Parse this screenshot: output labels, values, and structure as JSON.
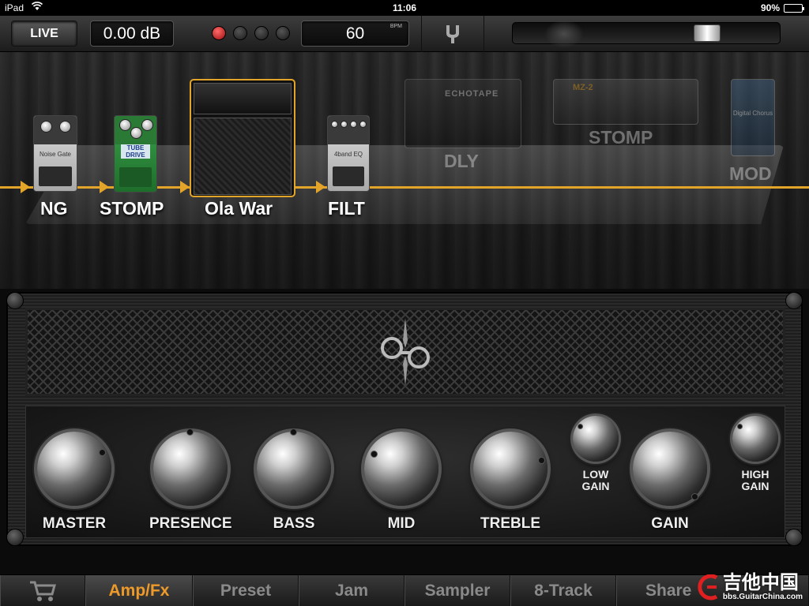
{
  "status_bar": {
    "device": "iPad",
    "time": "11:06",
    "battery": "90%",
    "battery_level": 0.9
  },
  "toolbar": {
    "live_label": "LIVE",
    "level_display": "0.00 dB",
    "bpm_value": "60",
    "bpm_unit": "BPM",
    "tuner_icon": "tuning-fork-icon",
    "volume_slider_level": 0.75,
    "record_led_color": "#c81818"
  },
  "signal_chain": {
    "accent_color": "#e3a42a",
    "units": [
      {
        "label": "NG",
        "device_text": "Noise Gate",
        "active": true
      },
      {
        "label": "STOMP",
        "device_text": "TUBE DRIVE",
        "active": true
      },
      {
        "label": "Ola War",
        "active": true,
        "selected": true
      },
      {
        "label": "FILT",
        "device_text": "4band EQ",
        "active": true
      },
      {
        "label": "DLY",
        "device_text": "ECHOTAPE",
        "active": false
      },
      {
        "label": "STOMP",
        "device_text": "MZ-2",
        "active": false
      },
      {
        "label": "MOD",
        "device_text": "Digital Chorus",
        "active": false
      }
    ]
  },
  "amp": {
    "knobs": [
      {
        "label": "MASTER"
      },
      {
        "label": "PRESENCE"
      },
      {
        "label": "BASS"
      },
      {
        "label": "MID"
      },
      {
        "label": "TREBLE"
      },
      {
        "label": "LOW\nGAIN",
        "line1": "LOW",
        "line2": "GAIN"
      },
      {
        "label": "GAIN"
      },
      {
        "label": "HIGH\nGAIN",
        "line1": "HIGH",
        "line2": "GAIN"
      }
    ]
  },
  "tabs": {
    "cart_icon": "shopping-cart-icon",
    "items": [
      {
        "label": "Amp/Fx",
        "active": true
      },
      {
        "label": "Preset"
      },
      {
        "label": "Jam"
      },
      {
        "label": "Sampler"
      },
      {
        "label": "8-Track"
      },
      {
        "label": "Share"
      }
    ],
    "active_color": "#ed9a2a"
  },
  "watermark": {
    "title": "吉他中国",
    "url": "bbs.GuitarChina.com"
  }
}
